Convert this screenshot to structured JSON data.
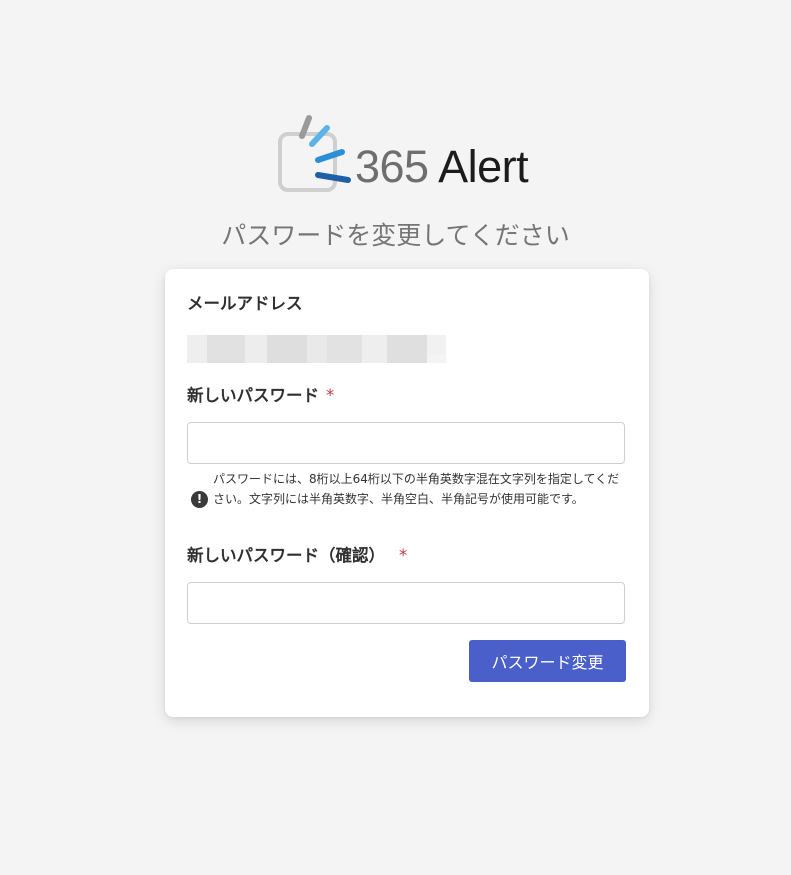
{
  "app": {
    "logo_number": "365",
    "logo_word": "Alert",
    "logo_colors": {
      "gray": "#9a9a9a",
      "light_blue": "#5bb3e6",
      "mid_blue": "#2b8fd6",
      "dark_blue": "#1f5fa8",
      "frame": "#cfcfcf"
    }
  },
  "page": {
    "title": "パスワードを変更してください"
  },
  "form": {
    "email_label": "メールアドレス",
    "email_value_masked": true,
    "new_password_label": "新しいパスワード",
    "new_password_value": "",
    "new_password_placeholder": "",
    "required_mark": "*",
    "hint_icon": "exclamation-circle-icon",
    "hint_text": "パスワードには、8桁以上64桁以下の半角英数字混在文字列を指定してください。文字列には半角英数字、半角空白、半角記号が使用可能です。",
    "confirm_password_label": "新しいパスワード（確認）",
    "confirm_password_value": "",
    "confirm_password_placeholder": "",
    "submit_label": "パスワード変更"
  },
  "colors": {
    "background": "#f4f4f4",
    "card": "#ffffff",
    "accent": "#4a5fc9",
    "required": "#c23b4a",
    "title_text": "#757575"
  }
}
